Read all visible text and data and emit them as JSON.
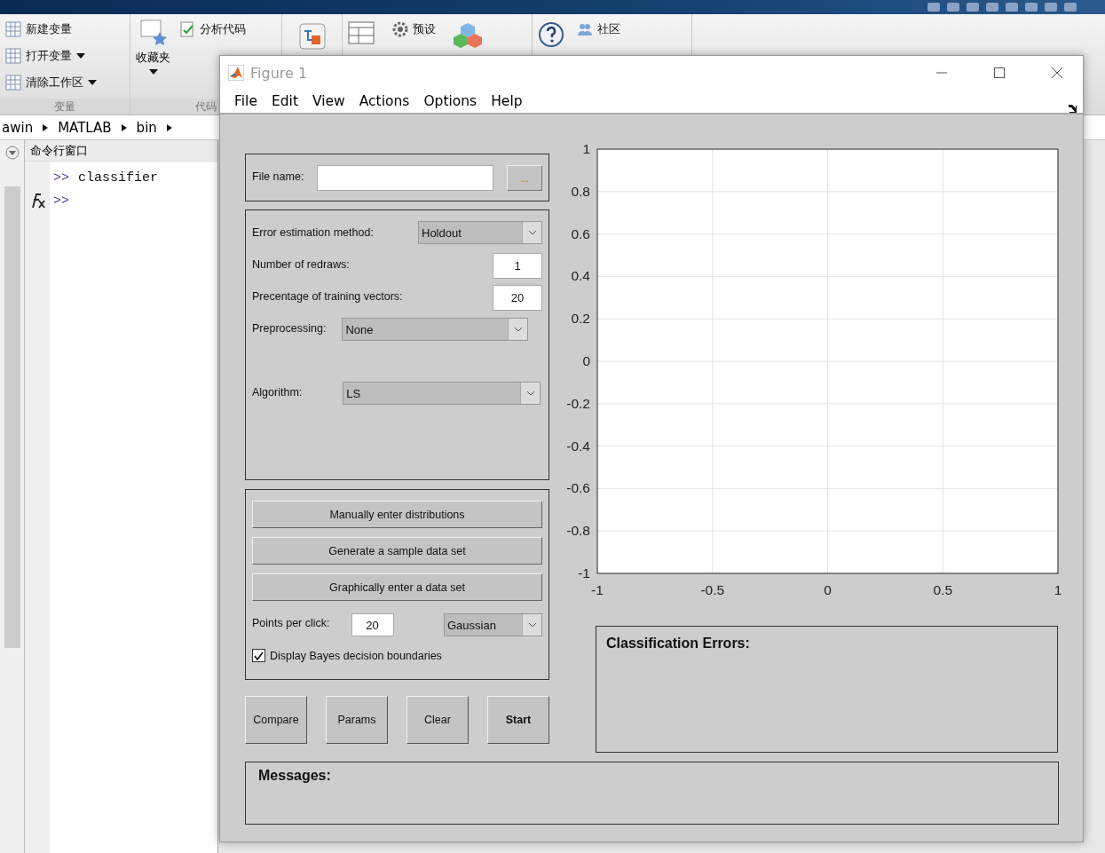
{
  "desktop": {
    "ribbon": {
      "variable_group": {
        "label": "变量",
        "items": [
          {
            "label": "新建变量",
            "has_menu": false
          },
          {
            "label": "打开变量",
            "has_menu": true
          },
          {
            "label": "清除工作区",
            "has_menu": true
          }
        ]
      },
      "favorites": {
        "label": "收藏夹"
      },
      "code_group": {
        "label": "代码",
        "items": [
          {
            "label": "分析代码"
          }
        ]
      },
      "environment": {
        "items": [
          {
            "label": "预设"
          }
        ]
      },
      "resources": {
        "items": [
          {
            "label": "社区"
          }
        ]
      }
    },
    "breadcrumb": [
      "awin",
      "MATLAB",
      "bin"
    ],
    "command_window": {
      "title": "命令行窗口",
      "lines": [
        {
          "prompt": ">>",
          "text": "classifier"
        },
        {
          "prompt": ">>"
        }
      ]
    }
  },
  "figure": {
    "title": "Figure 1",
    "menu": [
      "File",
      "Edit",
      "View",
      "Actions",
      "Options",
      "Help"
    ],
    "file_name": {
      "label": "File name:",
      "browse": "..."
    },
    "error_method": {
      "label": "Error estimation method:",
      "value": "Holdout"
    },
    "redraws": {
      "label": "Number of redraws:",
      "value": "1"
    },
    "training": {
      "label": "Precentage of training vectors:",
      "value": "20"
    },
    "preprocessing": {
      "label": "Preprocessing:",
      "value": "None"
    },
    "algorithm": {
      "label": "Algorithm:",
      "value": "LS"
    },
    "data_buttons": [
      "Manually enter distributions",
      "Generate a sample data set",
      "Graphically enter a data set"
    ],
    "points_per_click": {
      "label": "Points per click:",
      "value": "20",
      "distribution": "Gaussian"
    },
    "bayes": {
      "label": "Display Bayes decision boundaries",
      "checked": true
    },
    "actions": [
      {
        "label": "Compare",
        "default": false
      },
      {
        "label": "Params",
        "default": false
      },
      {
        "label": "Clear",
        "default": false
      },
      {
        "label": "Start",
        "default": true
      }
    ],
    "chart_data": {
      "type": "line",
      "grid": true,
      "xlim": [
        -1,
        1
      ],
      "ylim": [
        -1,
        1
      ],
      "xticks": [
        -1,
        -0.5,
        0,
        0.5,
        1
      ],
      "yticks": [
        -1,
        -0.8,
        -0.6,
        -0.4,
        -0.2,
        0,
        0.2,
        0.4,
        0.6,
        0.8,
        1
      ]
    },
    "classification_errors": {
      "title": "Classification Errors:"
    },
    "messages": {
      "title": "Messages:"
    }
  }
}
